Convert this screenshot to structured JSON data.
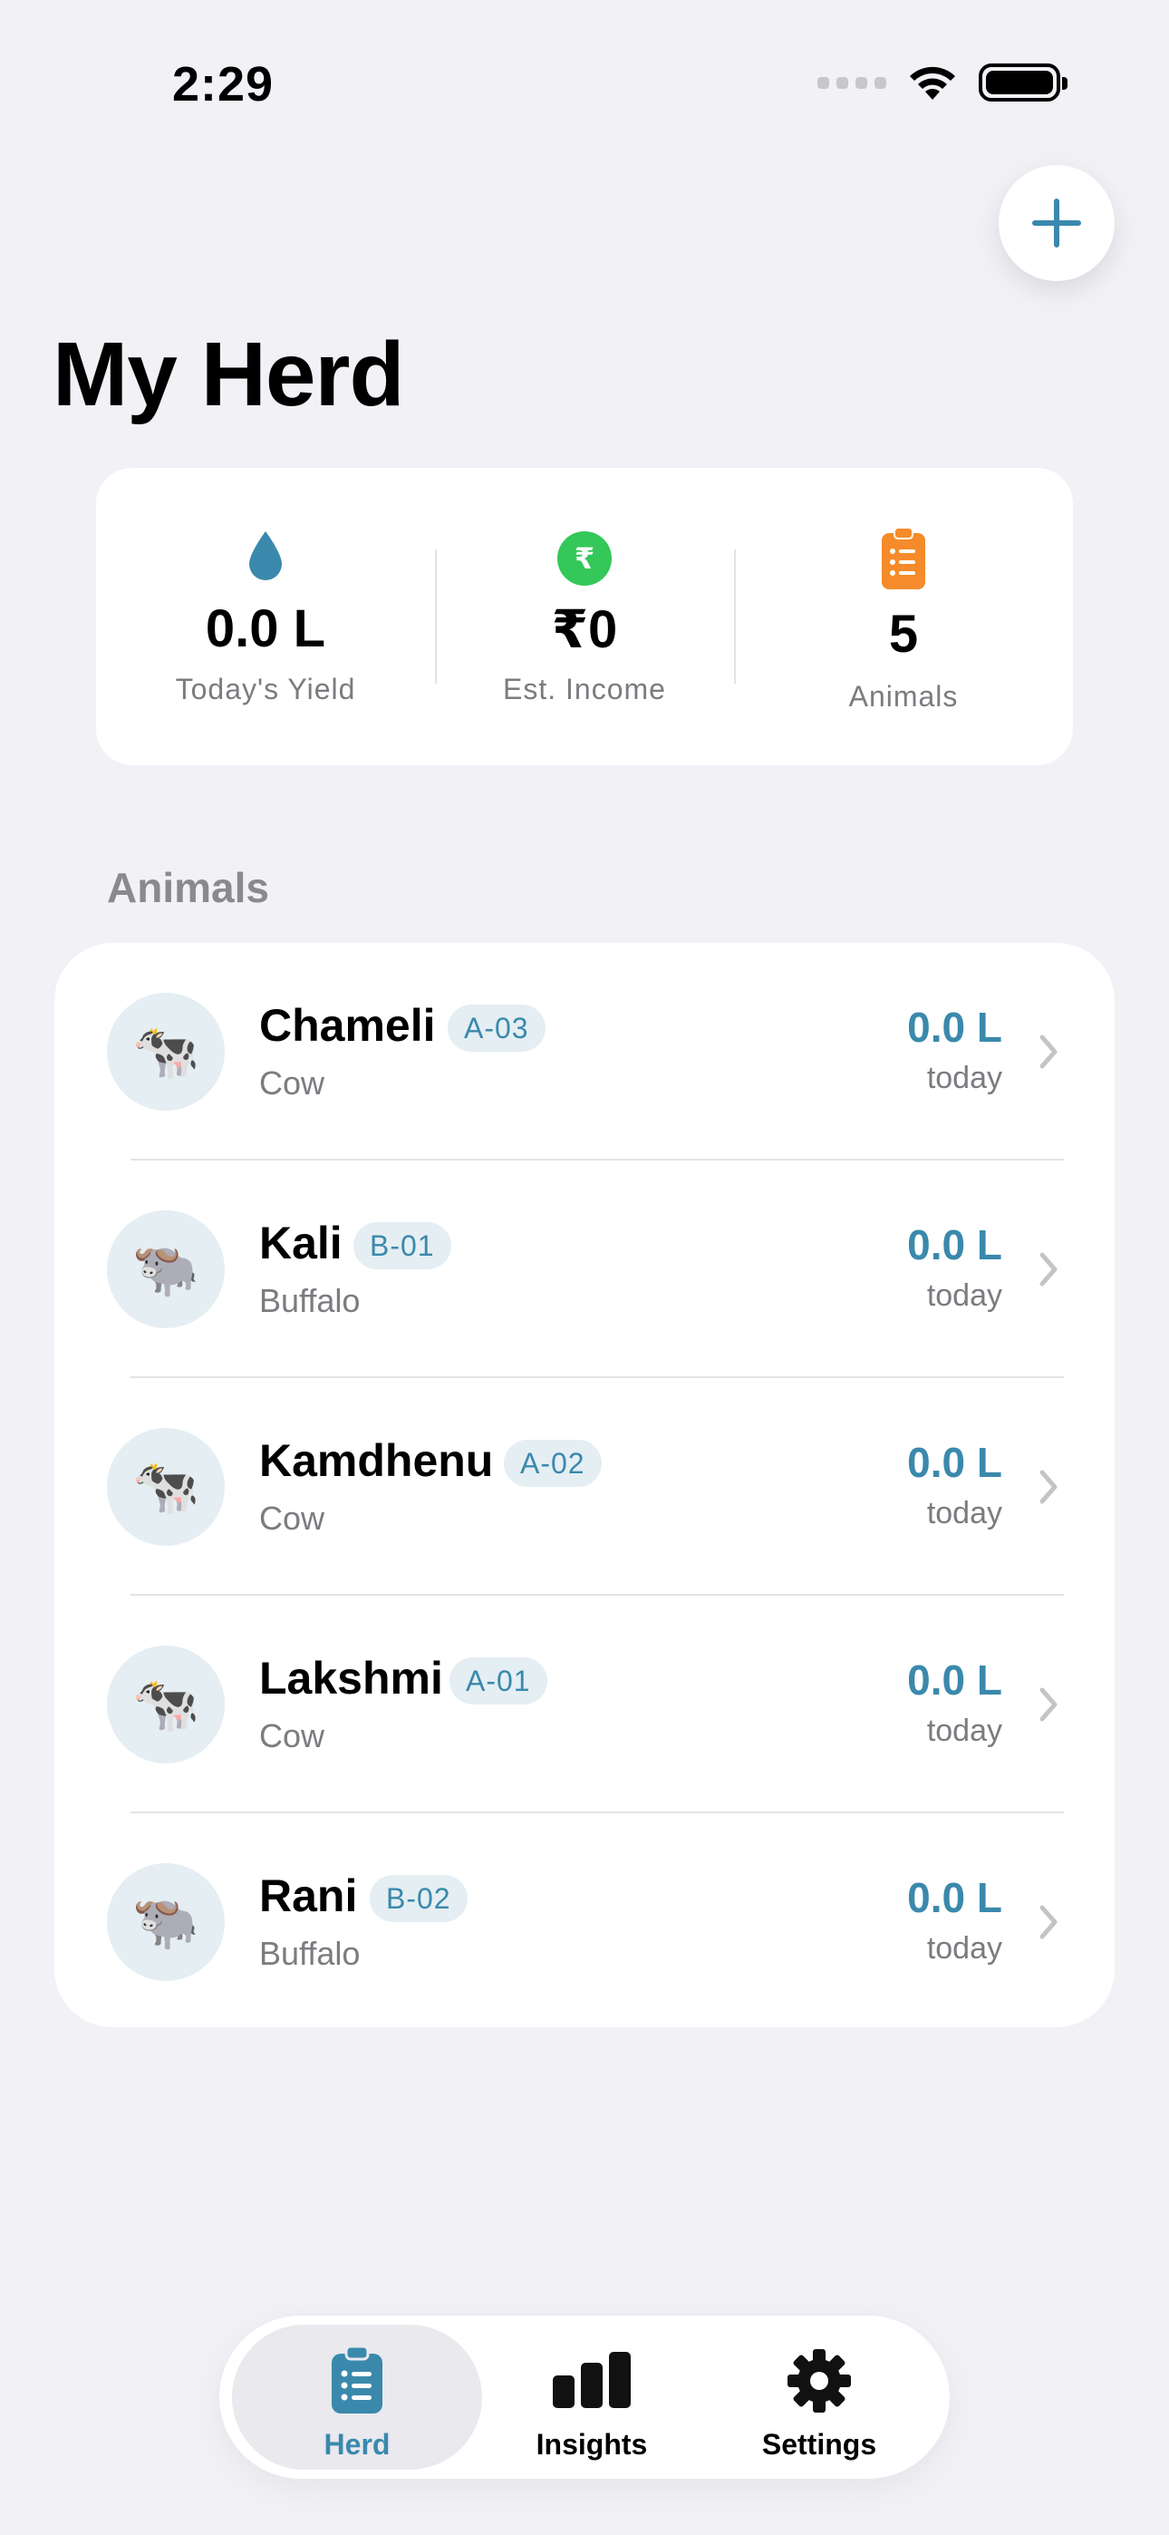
{
  "status_bar": {
    "time": "2:29"
  },
  "header": {
    "title": "My Herd",
    "add_icon": "plus-icon"
  },
  "summary": {
    "yield": {
      "value": "0.0 L",
      "label": "Today's Yield",
      "icon": "water-drop-icon"
    },
    "income": {
      "value": "₹0",
      "label": "Est. Income",
      "icon": "rupee-icon"
    },
    "animals": {
      "value": "5",
      "label": "Animals",
      "icon": "clipboard-icon"
    }
  },
  "section": {
    "title": "Animals"
  },
  "animals": [
    {
      "name": "Chameli",
      "tag": "A-03",
      "type": "Cow",
      "yield": "0.0 L",
      "caption": "today",
      "icon": "🐄"
    },
    {
      "name": "Kali",
      "tag": "B-01",
      "type": "Buffalo",
      "yield": "0.0 L",
      "caption": "today",
      "icon": "🐃"
    },
    {
      "name": "Kamdhenu",
      "tag": "A-02",
      "type": "Cow",
      "yield": "0.0 L",
      "caption": "today",
      "icon": "🐄"
    },
    {
      "name": "Lakshmi",
      "tag": "A-01",
      "type": "Cow",
      "yield": "0.0 L",
      "caption": "today",
      "icon": "🐄"
    },
    {
      "name": "Rani",
      "tag": "B-02",
      "type": "Buffalo",
      "yield": "0.0 L",
      "caption": "today",
      "icon": "🐃"
    }
  ],
  "tab_bar": {
    "herd": "Herd",
    "insights": "Insights",
    "settings": "Settings"
  },
  "colors": {
    "accent": "#3A89AC",
    "income_green": "#34C759",
    "animals_orange": "#F58B2A",
    "background": "#F1F1F6"
  }
}
